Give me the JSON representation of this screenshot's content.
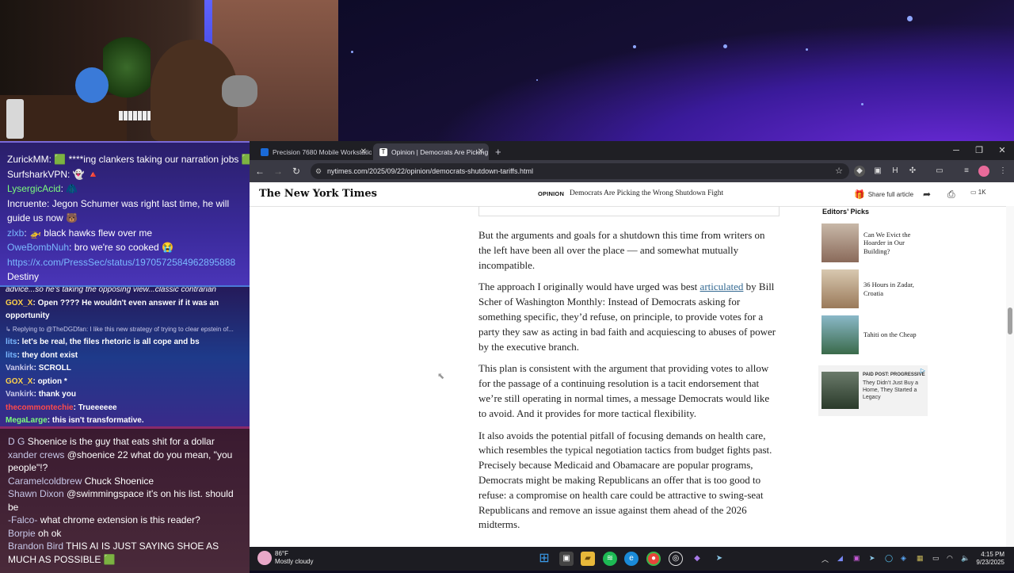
{
  "chat_top": {
    "messages": [
      {
        "user": "ZurickMM",
        "color": "#ffffff",
        "text": "🟩 ****ing clankers taking our narration jobs 🟩"
      },
      {
        "user": "SurfsharkVPN",
        "color": "#ffffff",
        "text": "👻 🔺"
      },
      {
        "user": "LysergicAcid",
        "color": "#7cfc7c",
        "text": "🧥"
      },
      {
        "user": "Incruente",
        "color": "#ffffff",
        "text": "Jegon Schumer was right last time, he will guide us now 🐻"
      },
      {
        "user": "zlxb",
        "color": "#7ab8ff",
        "text": "🚁 black hawks flew over me"
      },
      {
        "user": "OweBombNuh",
        "color": "#7ab8ff",
        "text": "bro we're so cooked 😭"
      },
      {
        "user": "",
        "color": "#7ab8ff",
        "text": "https://x.com/PressSec/status/1970572584962895888"
      },
      {
        "user": "Destiny",
        "color": "#ffffff",
        "text": ""
      }
    ]
  },
  "chat_mid": {
    "messages": [
      {
        "user": "",
        "color": "#ffffff",
        "text": "advice...so he's taking the opposing view...classic contrarian"
      },
      {
        "user": "GOX_X",
        "color": "#ffd24a",
        "text": "Open ???? He wouldn't even answer if it was an"
      },
      {
        "user": "",
        "color": "#ffffff",
        "text": "opportunity"
      },
      {
        "user": "",
        "color": "#c8c8e8",
        "text": "↳ Replying to @TheDGDfan: I like this new strategy of trying to clear epstein of..."
      },
      {
        "user": "lits",
        "color": "#7ab8ff",
        "text": "let's be real, the files rhetoric is all cope and bs"
      },
      {
        "user": "lits",
        "color": "#7ab8ff",
        "text": "they dont exist"
      },
      {
        "user": "Vankirk",
        "color": "#c8c8e8",
        "text": "SCROLL"
      },
      {
        "user": "GOX_X",
        "color": "#ffd24a",
        "text": "option *"
      },
      {
        "user": "Vankirk",
        "color": "#c8c8e8",
        "text": "thank you"
      },
      {
        "user": "thecommontechie",
        "color": "#ff4a4a",
        "text": "Trueeeeee"
      },
      {
        "user": "MegaLarge",
        "color": "#7cfc7c",
        "text": "this isn't transformative."
      }
    ]
  },
  "chat_bottom": {
    "messages": [
      {
        "user": "D G",
        "text": "Shoenice is the guy that eats shit for a dollar"
      },
      {
        "user": "xander crews",
        "text": "@shoenice 22 what do you mean, \"you people\"!?"
      },
      {
        "user": "Caramelcoldbrew",
        "text": "Chuck Shoenice"
      },
      {
        "user": "Shawn Dixon",
        "text": "@swimmingspace it's on his list. should be"
      },
      {
        "user": "-Falco-",
        "text": "what chrome extension is this reader?"
      },
      {
        "user": "Borpie",
        "text": "oh ok"
      },
      {
        "user": "Brandon Bird",
        "text": "THIS AI IS JUST SAYING SHOE AS MUCH AS POSSIBLE 🟩"
      }
    ]
  },
  "browser": {
    "tabs": [
      {
        "label": "Precision 7680 Mobile Workstation"
      },
      {
        "label": "Opinion | Democrats Are Picking"
      }
    ],
    "new_tab": "+",
    "window_controls": {
      "minimize": "─",
      "maximize": "❐",
      "close": "✕"
    },
    "url": "nytimes.com/2025/09/22/opinion/democrats-shutdown-tariffs.html",
    "nav": {
      "back": "←",
      "forward": "→",
      "reload": "↻"
    }
  },
  "nyt": {
    "logo": "The New York Times",
    "section": "OPINION",
    "headline": "Democrats Are Picking the Wrong Shutdown Fight",
    "share_label": "Share full article",
    "comments_count": "1K",
    "article": {
      "p1": "But the arguments and goals for a shutdown this time from writers on the left have been all over the place — and somewhat mutually incompatible.",
      "p2_before": "The approach I originally would have urged was best ",
      "p2_link": "articulated",
      "p2_after": " by Bill Scher of Washington Monthly: Instead of Democrats asking for something specific, they’d refuse, on principle, to provide votes for a party they saw as acting in bad faith and acquiescing to abuses of power by the executive branch.",
      "p3": "This plan is consistent with the argument that providing votes to allow for the passage of a continuing resolution is a tacit endorsement that we’re still operating in normal times, a message Democrats would like to avoid. And it provides for more tactical flexibility.",
      "p4": "It also avoids the potential pitfall of focusing demands on health care, which resembles the typical negotiation tactics from budget fights past. Precisely because Medicaid and Obamacare are popular programs, Democrats might be making Republicans an offer that is too good to refuse: a compromise on health care could be attractive to swing-seat Republicans and remove an issue against them ahead of the 2026 midterms."
    },
    "editors_picks": {
      "title": "Editors’ Picks",
      "items": [
        {
          "label": "Can We Evict the Hoarder in Our Building?"
        },
        {
          "label": "36 Hours in Zadar, Croatia"
        },
        {
          "label": "Tahiti on the Cheap"
        }
      ]
    },
    "ad": {
      "sponsor": "PAID POST: PROGRESSIVE",
      "text": "They Didn’t Just Buy a Home, They Started a Legacy"
    }
  },
  "taskbar": {
    "weather_temp": "86°F",
    "weather_desc": "Mostly cloudy",
    "time": "4:15 PM",
    "date": "9/23/2025"
  }
}
